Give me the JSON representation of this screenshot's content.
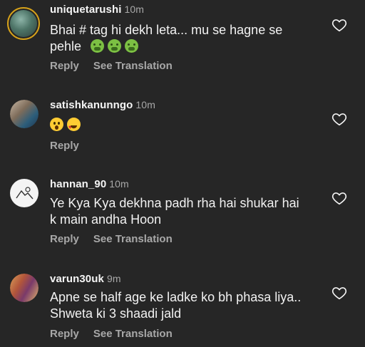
{
  "comments": [
    {
      "username": "uniquetarushi",
      "time": "10m",
      "lines": [
        "Bhai # tag hi dekh leta... mu se hagne se",
        "pehle"
      ],
      "emojis": [
        "nauseated-face",
        "nauseated-face",
        "nauseated-face"
      ],
      "actions": [
        "Reply",
        "See Translation"
      ]
    },
    {
      "username": "satishkanunngo",
      "time": "10m",
      "lines": [
        ""
      ],
      "emojis": [
        "astonished-face",
        "heart-eyes-face"
      ],
      "actions": [
        "Reply"
      ]
    },
    {
      "username": "hannan_90",
      "time": "10m",
      "lines": [
        "Ye Kya Kya dekhna padh rha hai shukar hai",
        "k main andha Hoon"
      ],
      "actions": [
        "Reply",
        "See Translation"
      ]
    },
    {
      "username": "varun30uk",
      "time": "9m",
      "lines": [
        "Apne se half age ke ladke ko bh phasa liya..",
        "Shweta ki 3 shaadi jald"
      ],
      "actions": [
        "Reply",
        "See Translation"
      ]
    }
  ],
  "icons": {
    "like": "heart-outline-icon"
  },
  "colors": {
    "background": "#262626",
    "secondary_text": "#a8a8a8",
    "story_ring": "#d6a21a"
  }
}
